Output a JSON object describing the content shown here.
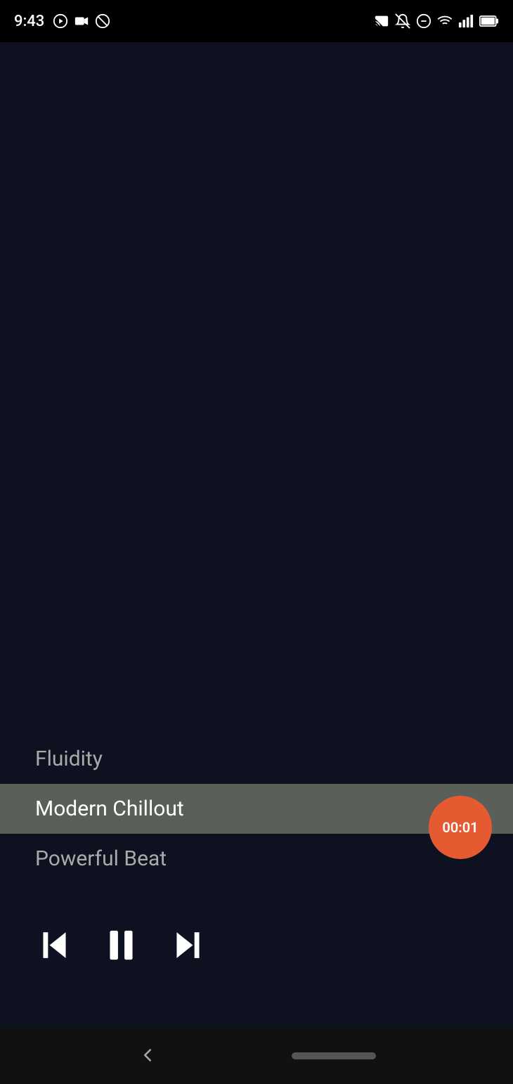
{
  "statusBar": {
    "time": "9:43",
    "leftIcons": [
      "play-circle-icon",
      "video-icon",
      "no-symbol-icon"
    ],
    "rightIcons": [
      "cast-icon",
      "mute-icon",
      "minus-circle-icon",
      "wifi-icon",
      "signal-icon",
      "battery-icon"
    ]
  },
  "trackList": {
    "items": [
      {
        "label": "Fluidity",
        "active": false
      },
      {
        "label": "Modern Chillout",
        "active": true
      },
      {
        "label": "Powerful Beat",
        "active": false
      }
    ]
  },
  "controls": {
    "prevLabel": "Previous",
    "pauseLabel": "Pause",
    "nextLabel": "Next"
  },
  "timerBadge": {
    "time": "00:01"
  },
  "navBar": {
    "backLabel": "Back"
  }
}
